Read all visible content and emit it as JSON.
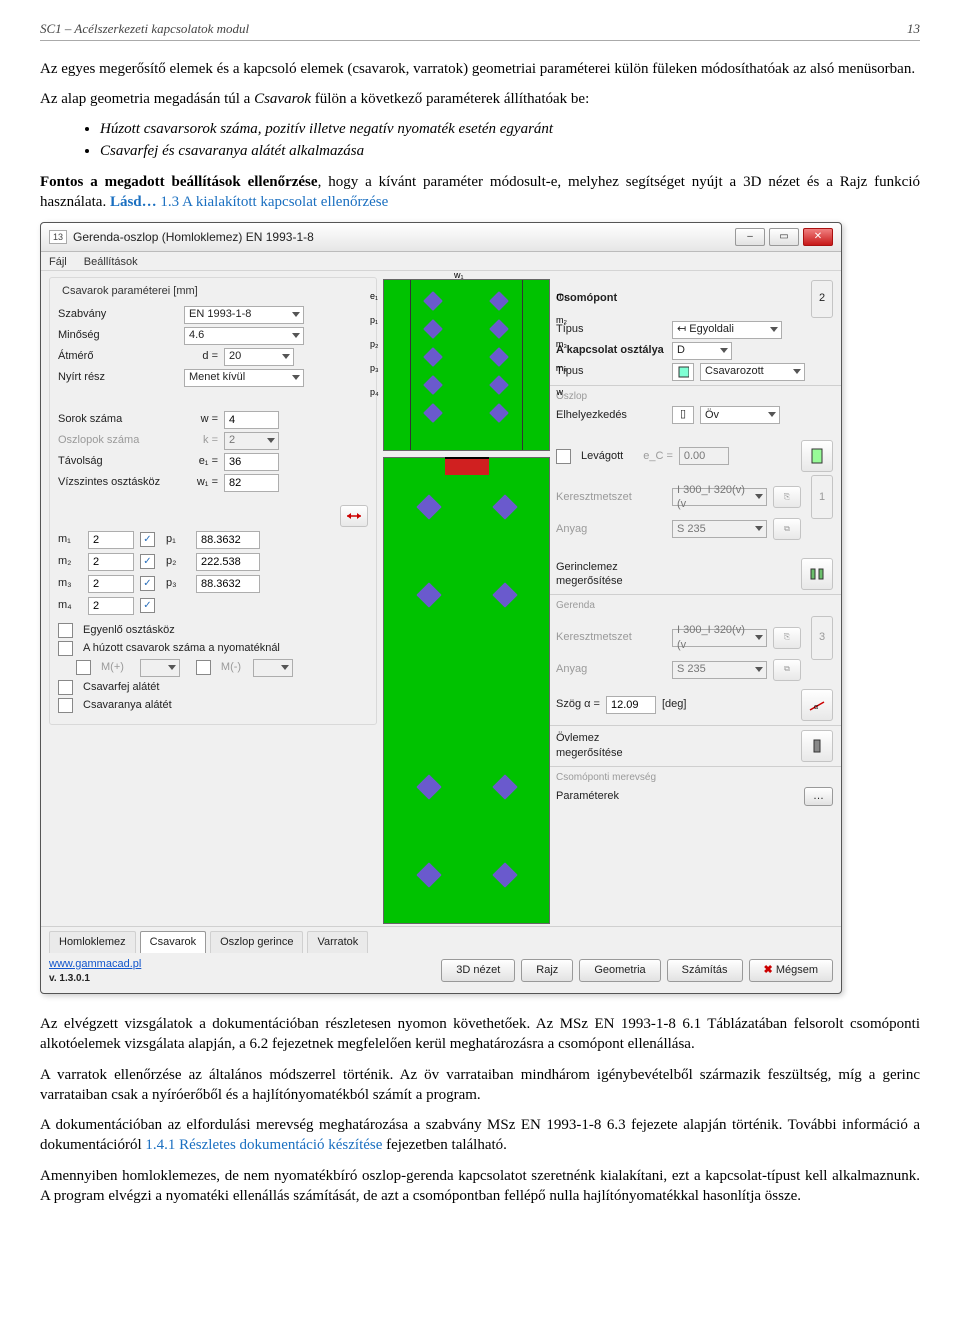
{
  "header": {
    "left": "SC1 – Acélszerkezeti kapcsolatok modul",
    "right": "13"
  },
  "doc": {
    "p1": "Az egyes megerősítő elemek és a kapcsoló elemek (csavarok, varratok) geometriai paraméterei külön füleken módosíthatóak az alsó menüsorban.",
    "p2a": "Az alap geometria megadásán túl a ",
    "p2i": "Csavarok",
    "p2b": " fülön a következő paraméterek állíthatóak be:",
    "li1": "Húzott csavarsorok száma, pozitív illetve negatív nyomaték esetén egyaránt",
    "li2": "Csavarfej és csavaranya alátét alkalmazása",
    "p3a": "Fontos a megadott beállítások ellenőrzése",
    "p3b": ", hogy a kívánt paraméter módosult-e, melyhez segítséget nyújt a 3D nézet és a Rajz funkció használata. ",
    "p3link1": "Lásd…",
    "p3link2": " 1.3 A kialakított kapcsolat ellenőrzése",
    "p4": "Az elvégzett vizsgálatok a dokumentációban részletesen nyomon követhetőek. Az MSz EN 1993-1-8 6.1 Táblázatában felsorolt csomóponti alkotóelemek vizsgálata alapján, a 6.2 fejezetnek megfelelően kerül meghatározásra a csomópont ellenállása.",
    "p5": "A varratok ellenőrzése az általános módszerrel történik. Az öv varrataiban mindhárom igénybevételből származik feszültség, míg a gerinc varrataiban csak a nyíróerőből és a hajlítónyomatékból számít a program.",
    "p6a": "A dokumentációban az elfordulási merevség meghatározása a szabvány MSz EN 1993-1-8 6.3 fejezete alapján történik. További információ a dokumentációról ",
    "p6link": "1.4.1 Részletes dokumentáció készítése",
    "p6b": " fejezetben található.",
    "p7": "Amennyiben homloklemezes, de nem nyomatékbíró oszlop-gerenda kapcsolatot szeretnénk kialakítani, ezt a kapcsolat-típust kell alkalmaznunk. A program elvégzi a nyomatéki ellenállás számítását, de azt a csomópontban fellépő nulla hajlítónyomatékkal hasonlítja össze."
  },
  "win": {
    "title": "Gerenda-oszlop (Homloklemez) EN 1993-1-8",
    "menu": {
      "file": "Fájl",
      "settings": "Beállítások"
    },
    "left": {
      "group1": "Csavarok paraméterei [mm]",
      "szabvany": "Szabvány",
      "szabvany_v": "EN 1993-1-8",
      "minoseg": "Minőség",
      "minoseg_v": "4.6",
      "atmero": "Átmérő",
      "atmero_eq": "d =",
      "atmero_v": "20",
      "nyirt": "Nyírt rész",
      "nyirt_v": "Menet kívül",
      "sorok": "Sorok száma",
      "sorok_eq": "w =",
      "sorok_v": "4",
      "oszlopok": "Oszlopok száma",
      "oszlopok_eq": "k =",
      "oszlopok_v": "2",
      "tavolsag": "Távolság",
      "tavolsag_eq": "e₁ =",
      "tavolsag_v": "36",
      "vosztas": "Vízszintes osztásköz",
      "vosztas_eq": "w₁ =",
      "vosztas_v": "82",
      "m1": "m₁",
      "m1v": "2",
      "p1": "p₁",
      "p1v": "88.3632",
      "m2": "m₂",
      "m2v": "2",
      "p2": "p₂",
      "p2v": "222.538",
      "m3": "m₃",
      "m3v": "2",
      "p3": "p₃",
      "p3v": "88.3632",
      "m4": "m₄",
      "m4v": "2",
      "egyenlo": "Egyenlő osztásköz",
      "huzott": "A húzott csavarok száma a nyomatéknál",
      "mp": "M(+)",
      "mm": "M(-)",
      "csavarfej": "Csavarfej alátét",
      "csavaranya": "Csavaranya alátét"
    },
    "right": {
      "csomopont": "Csomópont",
      "tipus": "Típus",
      "tipus_v": "Egyoldali",
      "kapcsosztaly": "A kapcsolat osztálya",
      "kapcsosztaly_v": "D",
      "tipus2": "Típus",
      "tipus2_v": "Csavarozott",
      "oszlop": "Oszlop",
      "elhelyezkedes": "Elhelyezkedés",
      "elhelyezkedes_v": "Öv",
      "levagott": "Levágott",
      "ec_eq": "e_C =",
      "ec_v": "0.00",
      "keresztmetszet": "Keresztmetszet",
      "km_v": "I 300_I 320(v)(v",
      "anyag": "Anyag",
      "anyag_v": "S 235",
      "gerincmeg": "Gerinclemez megerősítése",
      "gerenda": "Gerenda",
      "szog": "Szög  α =",
      "szog_v": "12.09",
      "szog_unit": "[deg]",
      "ovlemez": "Övlemez megerősítése",
      "csomomerev": "Csomóponti merevség",
      "parameterek": "Paraméterek"
    },
    "tabs": {
      "t1": "Homloklemez",
      "t2": "Csavarok",
      "t3": "Oszlop gerince",
      "t4": "Varratok"
    },
    "footer": {
      "link": "www.gammacad.pl",
      "ver": "v. 1.3.0.1",
      "b1": "3D nézet",
      "b2": "Rajz",
      "b3": "Geometria",
      "b4": "Számítás",
      "b5": "Mégsem"
    },
    "nums": {
      "two": "2",
      "one": "1",
      "three": "3"
    }
  }
}
